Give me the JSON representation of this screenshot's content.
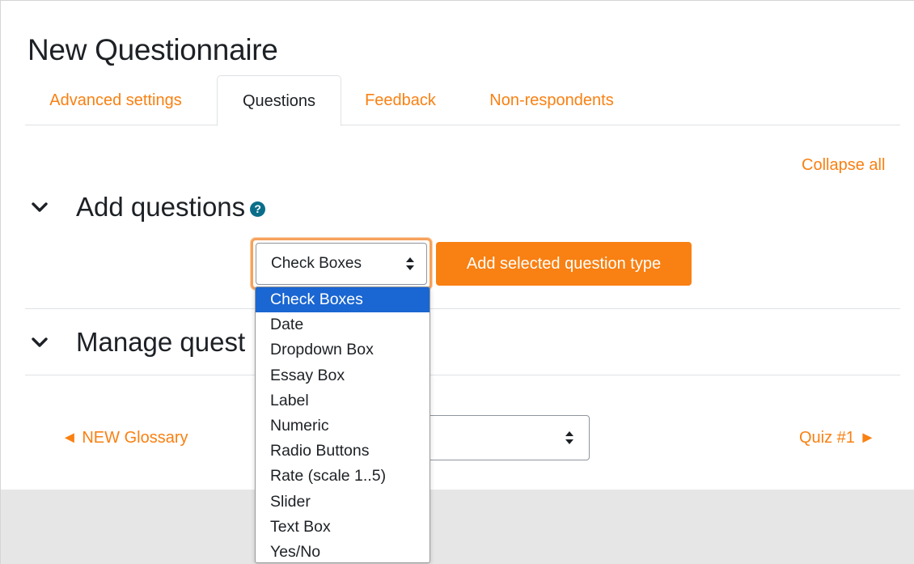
{
  "page": {
    "title": "New Questionnaire"
  },
  "tabs": [
    {
      "label": "Advanced settings",
      "active": false
    },
    {
      "label": "Questions",
      "active": true
    },
    {
      "label": "Feedback",
      "active": false
    },
    {
      "label": "Non-respondents",
      "active": false
    }
  ],
  "collapse_all": "Collapse all",
  "sections": {
    "add": {
      "title": "Add questions",
      "help_icon": "question-circle-icon"
    },
    "manage": {
      "title": "Manage quest"
    }
  },
  "question_type_select": {
    "value": "Check Boxes",
    "options": [
      "Check Boxes",
      "Date",
      "Dropdown Box",
      "Essay Box",
      "Label",
      "Numeric",
      "Radio Buttons",
      "Rate (scale 1..5)",
      "Slider",
      "Text Box",
      "Yes/No"
    ],
    "selected_index": 0
  },
  "add_button": {
    "label": "Add selected question type"
  },
  "nav": {
    "prev": "◄ NEW Glossary",
    "next": "Quiz #1 ►"
  },
  "colors": {
    "accent": "#f98012",
    "selected_option": "#1a66d2",
    "help_icon": "#0a6e8a"
  }
}
